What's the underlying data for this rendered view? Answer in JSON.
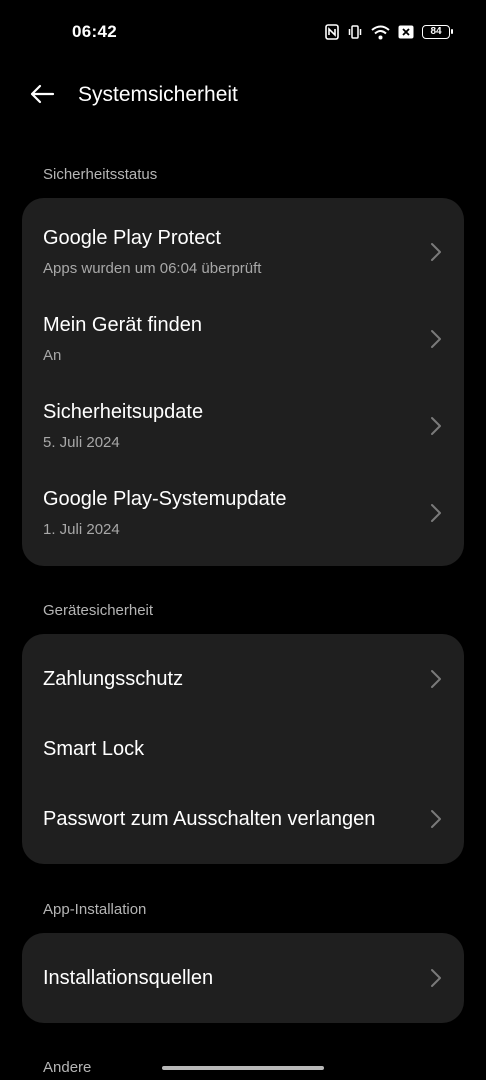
{
  "status_bar": {
    "time": "06:42",
    "icons": [
      "nfc-icon",
      "vibrate-icon",
      "wifi-icon",
      "no-sim-icon"
    ],
    "battery": "84"
  },
  "header": {
    "back_icon": "arrow-left-icon",
    "title": "Systemsicherheit"
  },
  "sections": {
    "security_status": {
      "label": "Sicherheitsstatus",
      "items": [
        {
          "title": "Google Play Protect",
          "subtitle": "Apps wurden um 06:04 überprüft"
        },
        {
          "title": "Mein Gerät finden",
          "subtitle": "An"
        },
        {
          "title": "Sicherheitsupdate",
          "subtitle": "5. Juli 2024"
        },
        {
          "title": "Google Play-Systemupdate",
          "subtitle": "1. Juli 2024"
        }
      ]
    },
    "device_security": {
      "label": "Gerätesicherheit",
      "items": [
        {
          "title": "Zahlungsschutz"
        },
        {
          "title": "Smart Lock"
        },
        {
          "title": "Passwort zum Ausschalten verlangen"
        }
      ]
    },
    "app_installation": {
      "label": "App-Installation",
      "items": [
        {
          "title": "Installationsquellen"
        }
      ]
    },
    "other": {
      "label": "Andere"
    }
  },
  "colors": {
    "background": "#000000",
    "card": "#1f1f1f",
    "secondary_text": "#a8a8a8",
    "section_text": "#b5b5b5"
  }
}
